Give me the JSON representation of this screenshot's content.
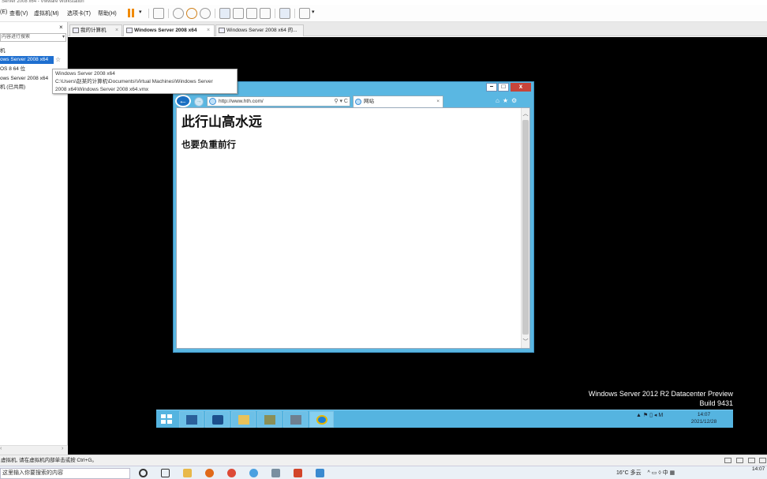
{
  "app": {
    "title": "Server 2008 x64 - VMware Workstation"
  },
  "menu": {
    "items": [
      "(E)",
      "查看(V)",
      "虚拟机(M)",
      "选项卡(T)",
      "帮助(H)"
    ]
  },
  "tabs": [
    {
      "label": "我的计算机",
      "active": false
    },
    {
      "label": "Windows Server 2008 x64",
      "active": true
    },
    {
      "label": "Windows Server 2008 x64 的...",
      "active": false
    }
  ],
  "library": {
    "search_placeholder": "内容进行搜索",
    "items": [
      {
        "label": "机",
        "selected": false
      },
      {
        "label": "ows Server 2008 x64",
        "selected": true
      },
      {
        "label": "OS 8 64 位",
        "selected": false
      },
      {
        "label": "ows Server 2008 x64",
        "selected": false
      },
      {
        "label": "机 (已共用)",
        "selected": false
      }
    ]
  },
  "tooltip": {
    "line1": "Windows Server 2008 x64",
    "line2": "C:\\Users\\赵某的计算机\\Documents\\Virtual Machines\\Windows Server",
    "line3": "2008 x64\\Windows Server 2008 x64.vmx"
  },
  "ie": {
    "address": "http://www.hth.com/",
    "address_controls": "⚲ ▾ C",
    "tab_title": "网站",
    "heading": "此行山高水远",
    "subline": "也要负重前行"
  },
  "guest": {
    "watermark_line1": "Windows Server 2012 R2 Datacenter Preview",
    "watermark_line2": "Build 9431",
    "clock_time": "14:07",
    "clock_date": "2021/12/28",
    "tray_text": "▲ ⚑ ▯ ◂ M"
  },
  "statusbar": {
    "text": "虚拟机, 请在虚拟机内部单击或按 Ctrl+G。"
  },
  "host_taskbar": {
    "search_placeholder": "这里输入你要搜索的内容",
    "weather": "16°C 多云",
    "tray_text": "^ ▭ ◊ 中 ▦",
    "clock_time": "14:07"
  },
  "colors": {
    "selection": "#1e6fd0",
    "ie_frame": "#5ab7e2",
    "guest_taskbar": "#55b4e0",
    "close_button": "#c7443a"
  }
}
